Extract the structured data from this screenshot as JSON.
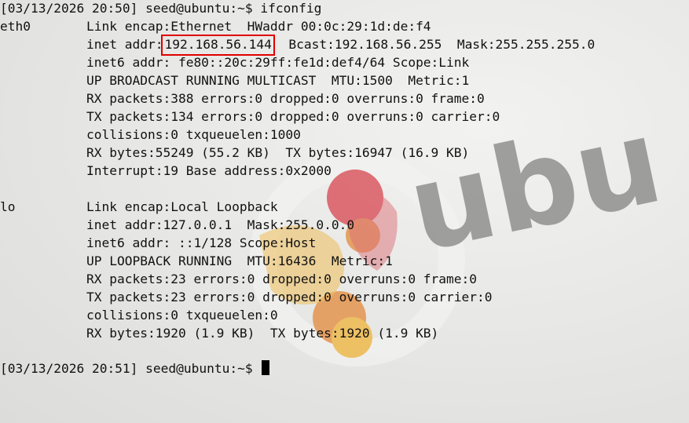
{
  "terminal": {
    "prompt1": "[03/13/2026 20:50] seed@ubuntu:~$ ifconfig",
    "eth0": {
      "name": "eth0",
      "link": "Link encap:Ethernet  HWaddr 00:0c:29:1d:de:f4",
      "inet_prefix": "inet addr:",
      "inet_addr": "192.168.56.144",
      "inet_suffix": "  Bcast:192.168.56.255  Mask:255.255.255.0",
      "inet6": "inet6 addr: fe80::20c:29ff:fe1d:def4/64 Scope:Link",
      "flags": "UP BROADCAST RUNNING MULTICAST  MTU:1500  Metric:1",
      "rx_packets": "RX packets:388 errors:0 dropped:0 overruns:0 frame:0",
      "tx_packets": "TX packets:134 errors:0 dropped:0 overruns:0 carrier:0",
      "collisions": "collisions:0 txqueuelen:1000",
      "bytes": "RX bytes:55249 (55.2 KB)  TX bytes:16947 (16.9 KB)",
      "interrupt": "Interrupt:19 Base address:0x2000"
    },
    "lo": {
      "name": "lo",
      "link": "Link encap:Local Loopback",
      "inet": "inet addr:127.0.0.1  Mask:255.0.0.0",
      "inet6": "inet6 addr: ::1/128 Scope:Host",
      "flags": "UP LOOPBACK RUNNING  MTU:16436  Metric:1",
      "rx_packets": "RX packets:23 errors:0 dropped:0 overruns:0 frame:0",
      "tx_packets": "TX packets:23 errors:0 dropped:0 overruns:0 carrier:0",
      "collisions": "collisions:0 txqueuelen:0",
      "bytes": "RX bytes:1920 (1.9 KB)  TX bytes:1920 (1.9 KB)"
    },
    "prompt2": "[03/13/2026 20:51] seed@ubuntu:~$ "
  },
  "wallpaper": {
    "logo_text": "ubu",
    "colors": {
      "logo_text": "#8a8a88",
      "circle_red": "#d8454f",
      "circle_orange": "#e38a3b",
      "circle_yellow": "#f0b43a"
    }
  },
  "highlight_color": "#e00000"
}
